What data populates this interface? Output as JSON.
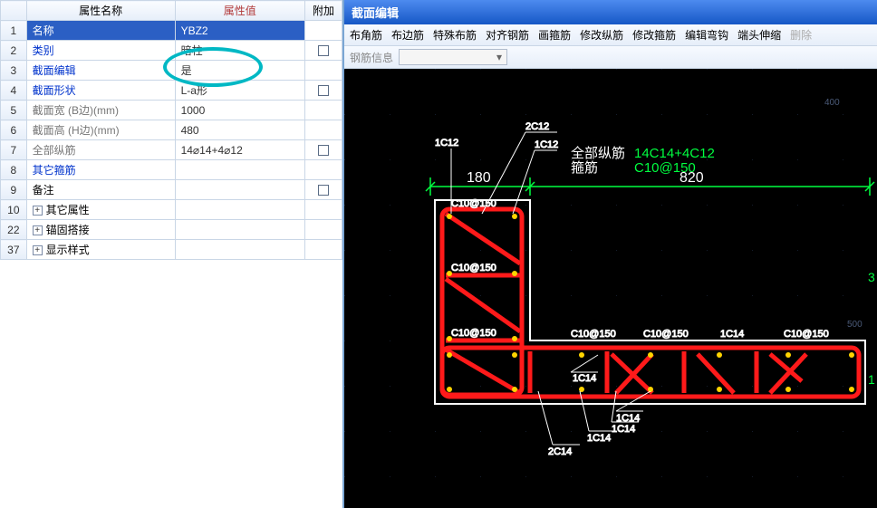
{
  "left": {
    "headers": {
      "index": "",
      "name": "属性名称",
      "value": "属性值",
      "addon": "附加"
    },
    "rows": [
      {
        "idx": "1",
        "name": "名称",
        "val": "YBZ2",
        "add": false,
        "sel": true
      },
      {
        "idx": "2",
        "name": "类别",
        "val": "暗柱",
        "add": true,
        "blue": true
      },
      {
        "idx": "3",
        "name": "截面编辑",
        "val": "是",
        "add": false,
        "blue": true
      },
      {
        "idx": "4",
        "name": "截面形状",
        "val": "L-a形",
        "add": true,
        "blue": true
      },
      {
        "idx": "5",
        "name": "截面宽 (B边)(mm)",
        "val": "1000",
        "add": false,
        "grey": true
      },
      {
        "idx": "6",
        "name": "截面高 (H边)(mm)",
        "val": "480",
        "add": false,
        "grey": true
      },
      {
        "idx": "7",
        "name": "全部纵筋",
        "val": "14⌀14+4⌀12",
        "add": true,
        "grey": true
      },
      {
        "idx": "8",
        "name": "其它箍筋",
        "val": "",
        "add": false,
        "blue": true
      },
      {
        "idx": "9",
        "name": "备注",
        "val": "",
        "add": true
      },
      {
        "idx": "10",
        "name": "其它属性",
        "val": "",
        "add": false,
        "exp": true
      },
      {
        "idx": "22",
        "name": "锚固搭接",
        "val": "",
        "add": false,
        "exp": true
      },
      {
        "idx": "37",
        "name": "显示样式",
        "val": "",
        "add": false,
        "exp": true
      }
    ]
  },
  "right": {
    "title": "截面编辑",
    "toolbar": [
      "布角筋",
      "布边筋",
      "特殊布筋",
      "对齐钢筋",
      "画箍筋",
      "修改纵筋",
      "修改箍筋",
      "编辑弯钩",
      "端头伸缩",
      "删除"
    ],
    "toolbar_disabled": [
      "删除"
    ],
    "infoLabel": "钢筋信息",
    "drawing": {
      "topDimLeft": "180",
      "topDimRight": "820",
      "labelAll": "全部纵筋",
      "labelAllVal": "14C14+4C12",
      "labelStir": "箍筋",
      "labelStirVal": "C10@150",
      "leaders": [
        "1C12",
        "2C12",
        "1C12",
        "C10@150",
        "C10@150",
        "C10@150",
        "C10@150",
        "1C14",
        "C10@150",
        "1C14",
        "1C14",
        "1C14",
        "1C14",
        "2C14"
      ],
      "sideMarks": [
        "400",
        "3",
        "500",
        "1"
      ]
    }
  },
  "chart_data": {
    "type": "diagram",
    "shape": "L-a",
    "width_mm": 1000,
    "height_mm": 480,
    "dims_top": [
      180,
      820
    ],
    "longitudinal": "14C14+4C12",
    "stirrup": "C10@150",
    "rebar_labels": [
      "1C12",
      "2C12",
      "1C12",
      "C10@150",
      "C10@150",
      "C10@150",
      "C10@150",
      "1C14",
      "1C14",
      "1C14",
      "1C14",
      "1C14",
      "2C14",
      "C10@150"
    ]
  }
}
